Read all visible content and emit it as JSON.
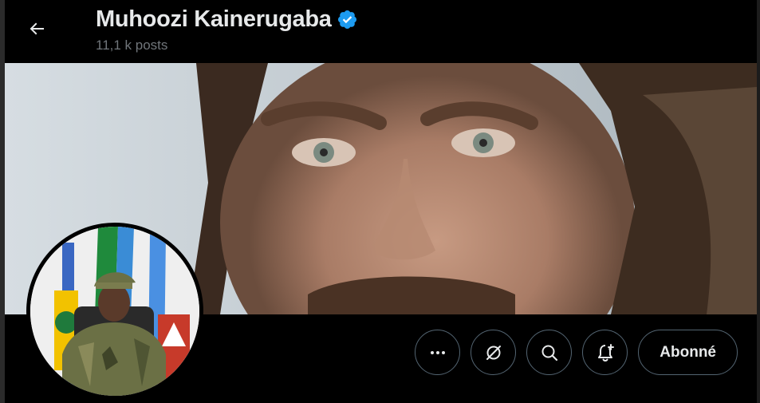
{
  "header": {
    "name": "Muhoozi Kainerugaba",
    "posts": "11,1 k posts"
  },
  "actions": {
    "more_icon": "more-horizontal-icon",
    "grok_icon": "grok-icon",
    "search_icon": "search-icon",
    "notify_icon": "bell-plus-icon",
    "follow_label": "Abonné"
  },
  "colors": {
    "background": "#000000",
    "text": "#e7e9ea",
    "muted": "#71767b",
    "border": "#536471",
    "verified": "#1d9bf0"
  }
}
